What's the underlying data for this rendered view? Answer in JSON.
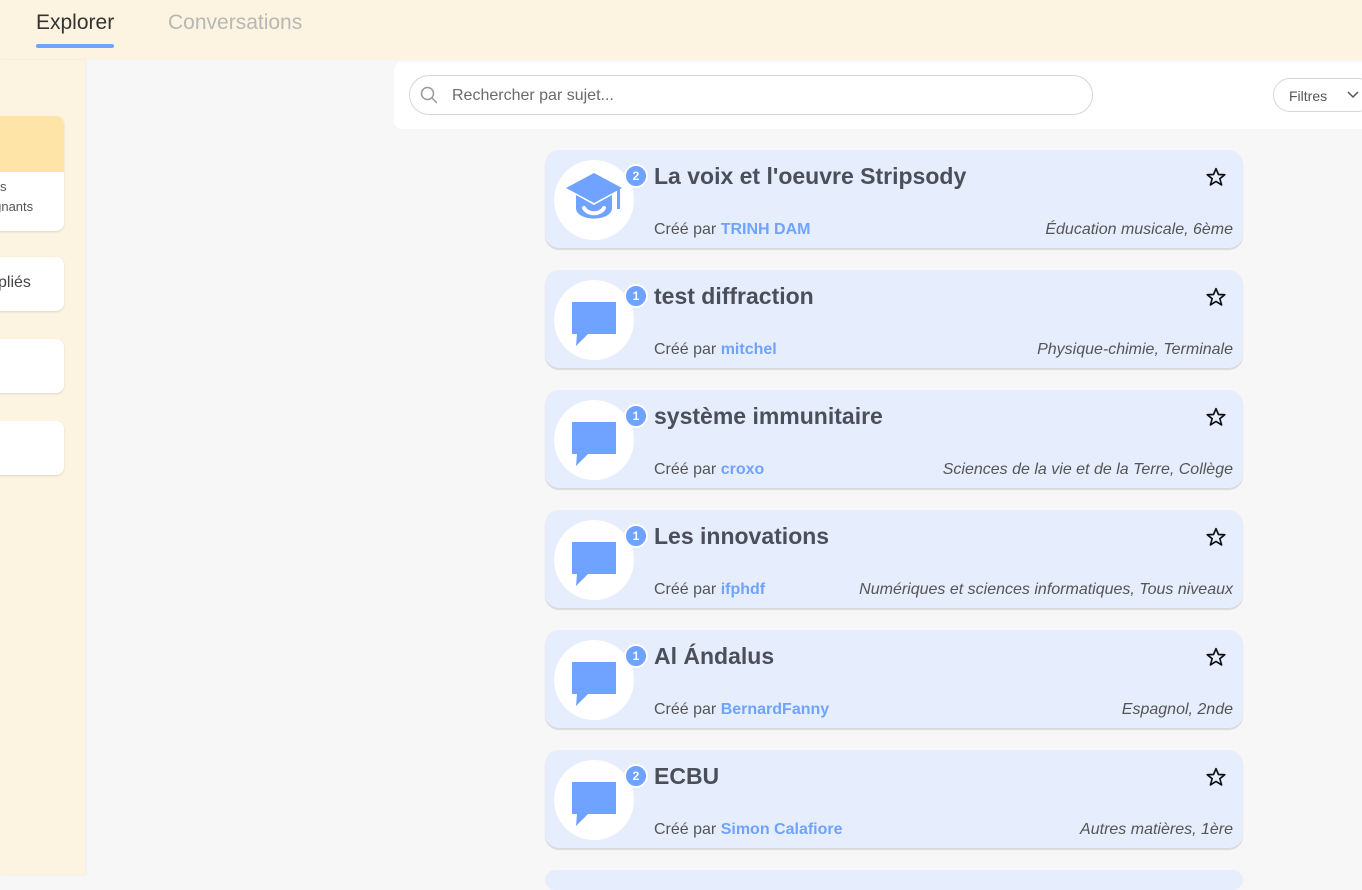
{
  "tabs": {
    "explorer": "Explorer",
    "conversations": "Conversations"
  },
  "sidebar": {
    "card1_line1": "s",
    "card1_line2": "eignants",
    "card2_label": "pliés"
  },
  "search": {
    "placeholder": "Rechercher par sujet...",
    "filters_label": "Filtres"
  },
  "created_prefix": "Créé par",
  "topics": [
    {
      "title": "La voix et l'oeuvre Stripsody",
      "author": "TRINH DAM",
      "meta": "Éducation musicale, 6ème",
      "count": "2",
      "icon": "graduation-cap-icon"
    },
    {
      "title": "test diffraction",
      "author": "mitchel",
      "meta": "Physique-chimie, Terminale",
      "count": "1",
      "icon": "speech-bubble-icon"
    },
    {
      "title": "système immunitaire",
      "author": "croxo",
      "meta": "Sciences de la vie et de la Terre, Collège",
      "count": "1",
      "icon": "speech-bubble-icon"
    },
    {
      "title": "Les innovations",
      "author": "ifphdf",
      "meta": "Numériques et sciences informatiques, Tous niveaux",
      "count": "1",
      "icon": "speech-bubble-icon"
    },
    {
      "title": "Al Ándalus",
      "author": "BernardFanny",
      "meta": "Espagnol, 2nde",
      "count": "1",
      "icon": "speech-bubble-icon"
    },
    {
      "title": "ECBU",
      "author": "Simon Calafiore",
      "meta": "Autres matières, 1ère",
      "count": "2",
      "icon": "speech-bubble-icon"
    }
  ],
  "colors": {
    "accent": "#6fa3ff",
    "card_bg": "#e6edfd",
    "header_bg": "#fdf3e1",
    "sidebar_highlight": "#ffe4a8"
  }
}
